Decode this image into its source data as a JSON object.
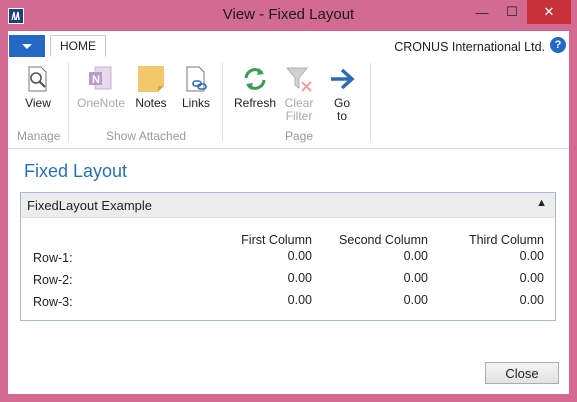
{
  "window": {
    "title": "View - Fixed Layout",
    "controls": {
      "minimize": "—",
      "maximize": "☐",
      "close": "✕"
    }
  },
  "ribbon": {
    "tab": "HOME",
    "company": "CRONUS International Ltd.",
    "help": "?",
    "buttons": {
      "view": "View",
      "onenote": "OneNote",
      "notes": "Notes",
      "links": "Links",
      "refresh": "Refresh",
      "clear_filter_1": "Clear",
      "clear_filter_2": "Filter",
      "goto_1": "Go",
      "goto_2": "to"
    },
    "groups": {
      "manage": "Manage",
      "show_attached": "Show Attached",
      "page": "Page"
    }
  },
  "page": {
    "title": "Fixed Layout",
    "fasttab_title": "FixedLayout Example",
    "columns": [
      "First Column",
      "Second Column",
      "Third Column"
    ],
    "rows": [
      {
        "label": "Row-1:",
        "values": [
          "0.00",
          "0.00",
          "0.00"
        ]
      },
      {
        "label": "Row-2:",
        "values": [
          "0.00",
          "0.00",
          "0.00"
        ]
      },
      {
        "label": "Row-3:",
        "values": [
          "0.00",
          "0.00",
          "0.00"
        ]
      }
    ],
    "close_label": "Close"
  },
  "colors": {
    "frame": "#d36a8f",
    "accent": "#2468c6",
    "title_blue": "#2a6fb5",
    "close_red": "#c7313a"
  }
}
